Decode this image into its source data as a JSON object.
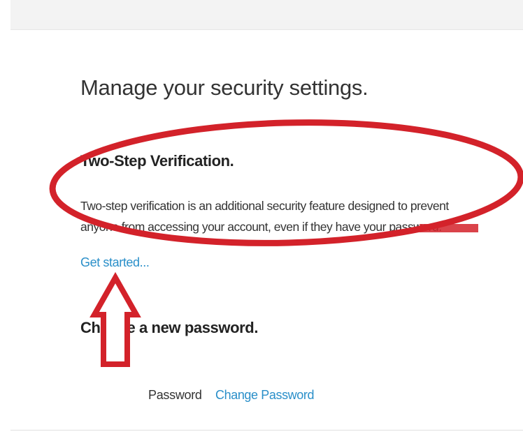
{
  "page": {
    "title": "Manage your security settings."
  },
  "two_step": {
    "heading": "Two-Step Verification.",
    "description": "Two-step verification is an additional security feature designed to prevent anyone from accessing your account, even if they have your password.",
    "link": "Get started..."
  },
  "password": {
    "heading": "Choose a new password.",
    "label": "Password",
    "link": "Change Password"
  },
  "annotations": {
    "highlight_color": "#d3222a",
    "shapes": [
      "ellipse",
      "up-arrow"
    ]
  },
  "colors": {
    "link": "#2a8fc9",
    "text": "#333333"
  }
}
